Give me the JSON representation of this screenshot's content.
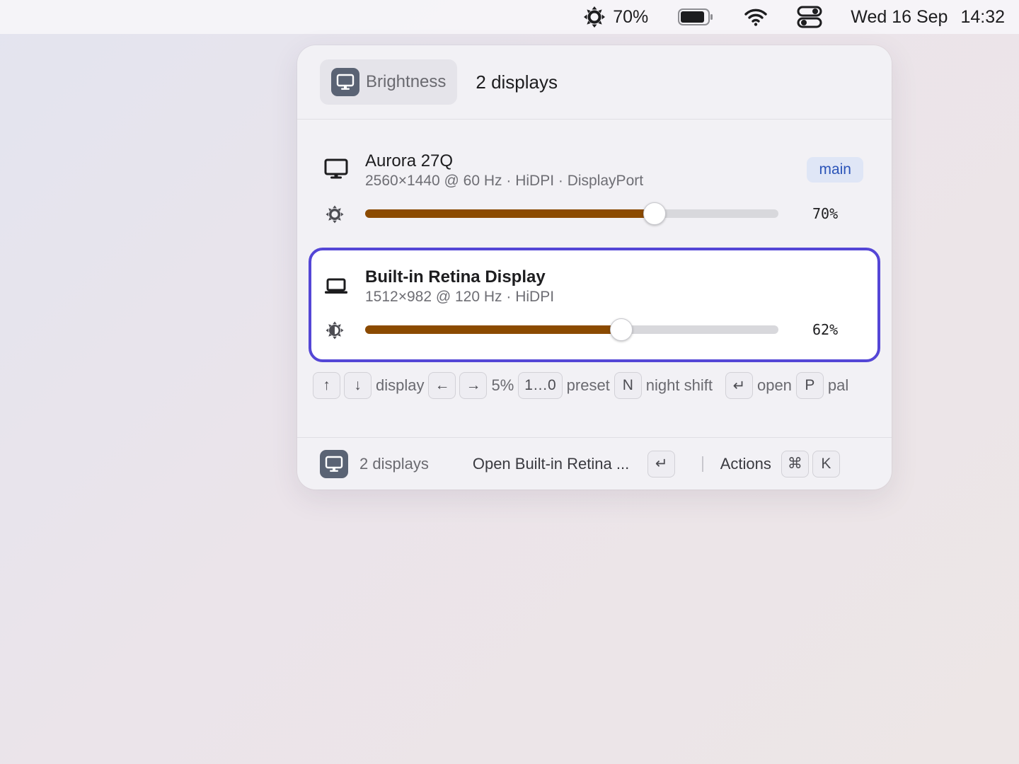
{
  "menubar": {
    "brightness_value": "70%",
    "date": "Wed 16 Sep",
    "time": "14:32",
    "icons": [
      "brightness-icon",
      "battery-icon",
      "wifi-icon",
      "control-center-icon"
    ]
  },
  "header": {
    "chip_label": "Brightness",
    "display_count": "2 displays"
  },
  "displays": [
    {
      "name": "Aurora 27Q",
      "spec": "2560×1440 @ 60 Hz · HiDPI · DisplayPort",
      "badge": "main",
      "brightness": 70,
      "brightness_label": "70%",
      "icon": "monitor-icon",
      "selected": false
    },
    {
      "name": "Built-in Retina Display",
      "spec": "1512×982 @ 120 Hz · HiDPI",
      "brightness": 62,
      "brightness_label": "62%",
      "icon": "laptop-icon",
      "selected": true
    }
  ],
  "hints": {
    "up_key": "↑",
    "down_key": "↓",
    "display_label": "display",
    "left_key": "←",
    "right_key": "→",
    "step_label": "5%",
    "preset_key": "1…0",
    "preset_label": "preset",
    "night_key": "N",
    "night_label": "night shift",
    "enter_key": "↵",
    "open_label": "open",
    "palette_key": "P",
    "palette_label": "pal"
  },
  "footer": {
    "display_count": "2 displays",
    "open_action": "Open Built-in Retina ...",
    "enter_key": "↵",
    "actions_label": "Actions",
    "cmd_key": "⌘",
    "k_key": "K"
  },
  "colors": {
    "accent_selection": "#5446d6",
    "slider_fill": "#8b4a00",
    "badge_bg": "#dfe6f6",
    "badge_text": "#2b54b8"
  }
}
